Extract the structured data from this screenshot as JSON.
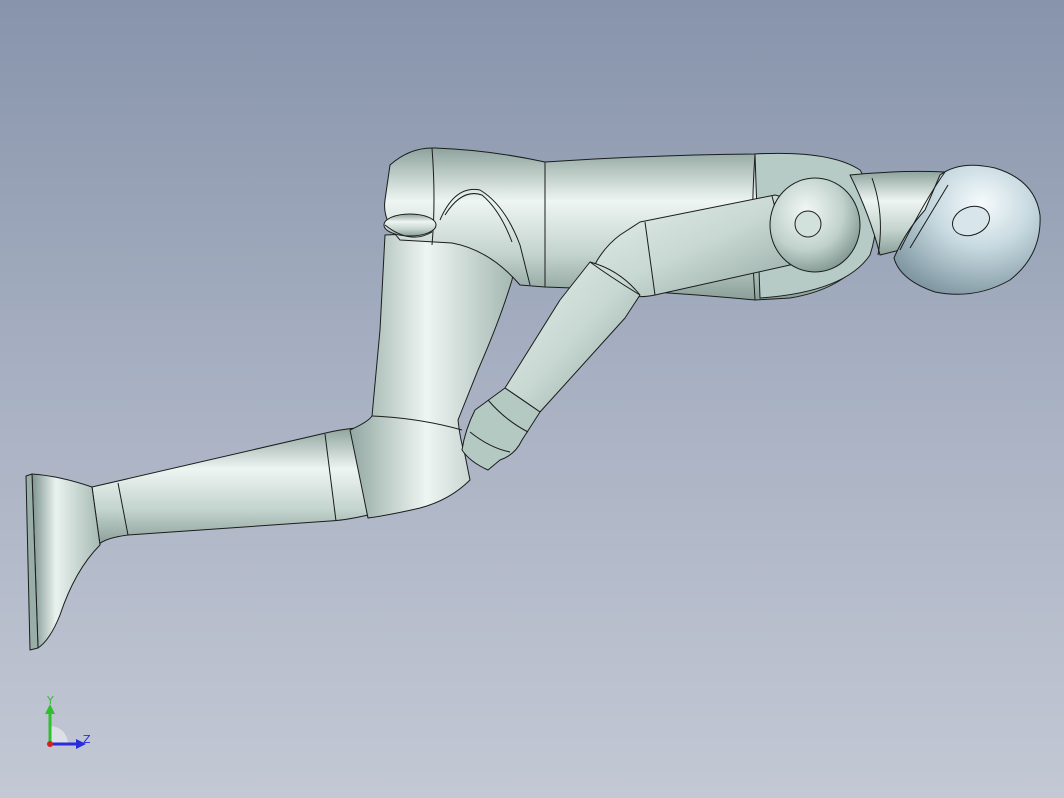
{
  "viewport": {
    "background_top": "#8794ab",
    "background_bottom": "#c3c8d4",
    "model_color": "#c3d3cd",
    "model_edge_color": "#1a1d1c"
  },
  "triad": {
    "y_label": "Y",
    "z_label": "Z",
    "y_color": "#2fbf2f",
    "z_color": "#2a2adf",
    "x_color": "#d42020"
  }
}
